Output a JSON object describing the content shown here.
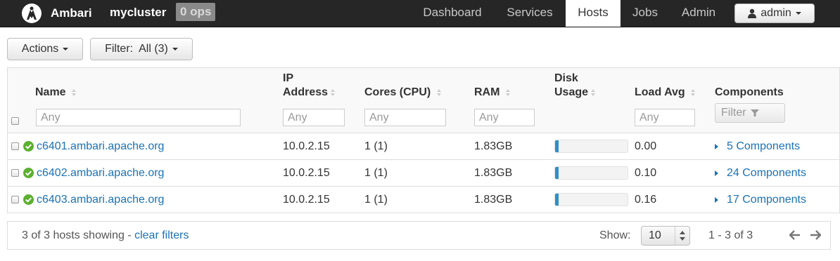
{
  "navbar": {
    "brand": "Ambari",
    "cluster": "mycluster",
    "ops_badge": "0 ops",
    "tabs": [
      {
        "label": "Dashboard",
        "active": false
      },
      {
        "label": "Services",
        "active": false
      },
      {
        "label": "Hosts",
        "active": true
      },
      {
        "label": "Jobs",
        "active": false
      },
      {
        "label": "Admin",
        "active": false
      }
    ],
    "user": "admin"
  },
  "toolbar": {
    "actions_label": "Actions",
    "filter_label": "Filter:  All (3)"
  },
  "table": {
    "headers": {
      "name": "Name",
      "ip_line1": "IP",
      "ip_line2": "Address",
      "cores": "Cores (CPU)",
      "ram": "RAM",
      "disk_line1": "Disk",
      "disk_line2": "Usage",
      "load": "Load Avg",
      "components": "Components"
    },
    "filters": {
      "name_placeholder": "Any",
      "ip_placeholder": "Any",
      "cores_placeholder": "Any",
      "ram_placeholder": "Any",
      "load_placeholder": "Any",
      "components_button": "Filter"
    },
    "rows": [
      {
        "name": "c6401.ambari.apache.org",
        "ip": "10.0.2.15",
        "cores": "1 (1)",
        "ram": "1.83GB",
        "disk_usage_pct": 5,
        "load": "0.00",
        "components": "5 Components",
        "status": "healthy"
      },
      {
        "name": "c6402.ambari.apache.org",
        "ip": "10.0.2.15",
        "cores": "1 (1)",
        "ram": "1.83GB",
        "disk_usage_pct": 5,
        "load": "0.10",
        "components": "24 Components",
        "status": "healthy"
      },
      {
        "name": "c6403.ambari.apache.org",
        "ip": "10.0.2.15",
        "cores": "1 (1)",
        "ram": "1.83GB",
        "disk_usage_pct": 5,
        "load": "0.16",
        "components": "17 Components",
        "status": "healthy"
      }
    ]
  },
  "footer": {
    "showing": "3 of 3 hosts showing",
    "separator": " - ",
    "clear_filters": "clear filters",
    "show_label": "Show:",
    "page_size": "10",
    "range": "1 - 3 of 3"
  },
  "colors": {
    "navbar_bg": "#262626",
    "link": "#1a72b5",
    "disk_fill": "#2f8fc7",
    "healthy": "#5cb030"
  }
}
